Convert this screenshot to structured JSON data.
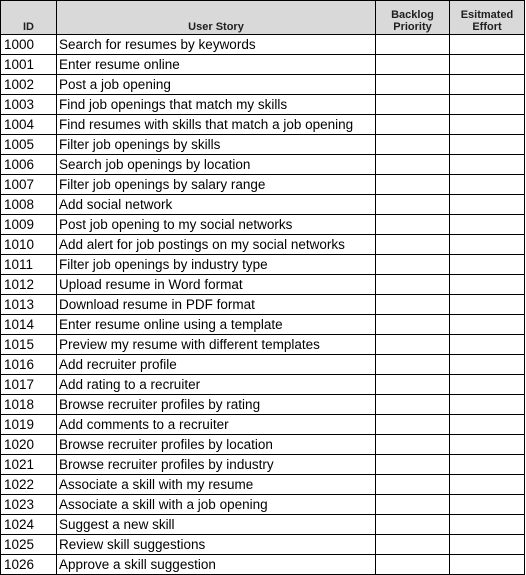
{
  "sheet": {
    "headers": {
      "id": "ID",
      "user_story": "User Story",
      "backlog_priority": [
        "Backlog",
        "Priority"
      ],
      "estimated_effort": [
        "Esitmated",
        "Effort"
      ]
    },
    "rows": [
      {
        "id": "1000",
        "story": "Search for resumes by keywords",
        "priority": "",
        "effort": ""
      },
      {
        "id": "1001",
        "story": "Enter resume online",
        "priority": "",
        "effort": ""
      },
      {
        "id": "1002",
        "story": "Post a job opening",
        "priority": "",
        "effort": ""
      },
      {
        "id": "1003",
        "story": "Find job openings that match my skills",
        "priority": "",
        "effort": ""
      },
      {
        "id": "1004",
        "story": "Find resumes with skills that match a job opening",
        "priority": "",
        "effort": ""
      },
      {
        "id": "1005",
        "story": "Filter job openings by skills",
        "priority": "",
        "effort": ""
      },
      {
        "id": "1006",
        "story": "Search job openings by location",
        "priority": "",
        "effort": ""
      },
      {
        "id": "1007",
        "story": "Filter job openings by salary range",
        "priority": "",
        "effort": ""
      },
      {
        "id": "1008",
        "story": "Add social network",
        "priority": "",
        "effort": ""
      },
      {
        "id": "1009",
        "story": "Post job opening to my social networks",
        "priority": "",
        "effort": ""
      },
      {
        "id": "1010",
        "story": "Add alert for job postings on my social networks",
        "priority": "",
        "effort": ""
      },
      {
        "id": "1011",
        "story": "Filter job openings by industry type",
        "priority": "",
        "effort": ""
      },
      {
        "id": "1012",
        "story": "Upload resume in Word format",
        "priority": "",
        "effort": ""
      },
      {
        "id": "1013",
        "story": "Download resume in PDF format",
        "priority": "",
        "effort": ""
      },
      {
        "id": "1014",
        "story": "Enter resume online using a template",
        "priority": "",
        "effort": ""
      },
      {
        "id": "1015",
        "story": "Preview my resume with different templates",
        "priority": "",
        "effort": ""
      },
      {
        "id": "1016",
        "story": "Add recruiter profile",
        "priority": "",
        "effort": ""
      },
      {
        "id": "1017",
        "story": "Add rating to a recruiter",
        "priority": "",
        "effort": ""
      },
      {
        "id": "1018",
        "story": "Browse recruiter profiles by rating",
        "priority": "",
        "effort": ""
      },
      {
        "id": "1019",
        "story": "Add comments to a recruiter",
        "priority": "",
        "effort": ""
      },
      {
        "id": "1020",
        "story": "Browse recruiter profiles by location",
        "priority": "",
        "effort": ""
      },
      {
        "id": "1021",
        "story": "Browse recruiter profiles by industry",
        "priority": "",
        "effort": ""
      },
      {
        "id": "1022",
        "story": "Associate a skill with my resume",
        "priority": "",
        "effort": ""
      },
      {
        "id": "1023",
        "story": "Associate a skill with a job opening",
        "priority": "",
        "effort": ""
      },
      {
        "id": "1024",
        "story": "Suggest a new skill",
        "priority": "",
        "effort": ""
      },
      {
        "id": "1025",
        "story": "Review skill suggestions",
        "priority": "",
        "effort": ""
      },
      {
        "id": "1026",
        "story": "Approve a skill suggestion",
        "priority": "",
        "effort": ""
      }
    ],
    "colors": {
      "header_bg": "#d9d9d9",
      "grid": "#000000",
      "cell_bg": "#ffffff"
    }
  }
}
